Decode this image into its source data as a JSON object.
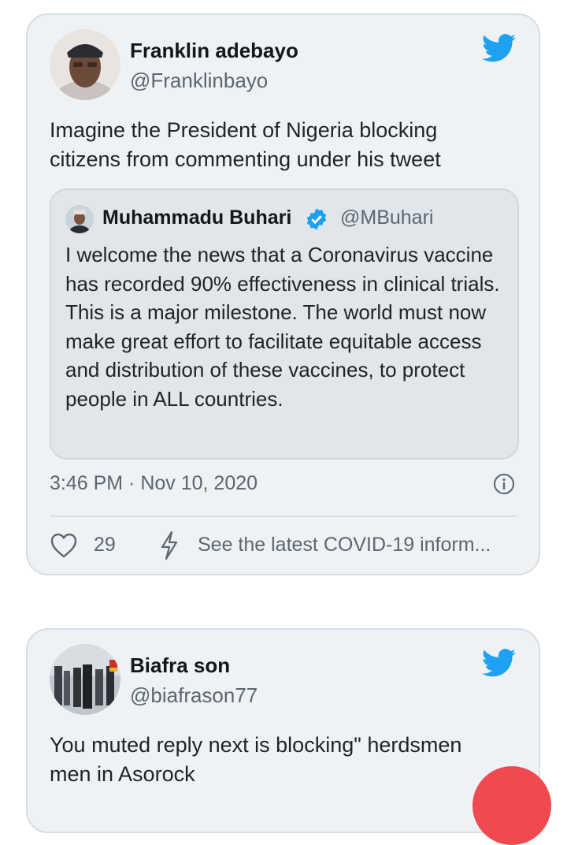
{
  "tweets": [
    {
      "author_name": "Franklin adebayo",
      "author_handle": "@Franklinbayo",
      "text": "Imagine the President of Nigeria blocking citizens from commenting under his tweet",
      "quoted": {
        "author_name": "Muhammadu Buhari",
        "author_handle": "@MBuhari",
        "verified": true,
        "text": "I welcome the news that a Coronavirus vaccine has recorded 90% effectiveness in clinical trials. This is a major milestone. The world must now make great effort to facilitate equitable access and distribution of these vaccines, to protect people in ALL countries."
      },
      "timestamp": "3:46 PM · Nov 10, 2020",
      "likes": "29",
      "covid_info": "See the latest COVID-19 inform..."
    },
    {
      "author_name": "Biafra son",
      "author_handle": "@biafrason77",
      "text": "You muted reply next is blocking\" herdsmen men in Asorock"
    }
  ],
  "icons": {
    "brand": "twitter-bird-icon",
    "verified": "verified-badge-icon",
    "info": "info-icon",
    "like": "heart-icon",
    "covid": "lightning-bolt-icon"
  },
  "colors": {
    "twitter_blue": "#1da1f2",
    "card_bg": "#eef2f5",
    "quote_bg": "#e1e6ea",
    "muted_text": "#5b6670",
    "fab_red": "#f0494f"
  }
}
